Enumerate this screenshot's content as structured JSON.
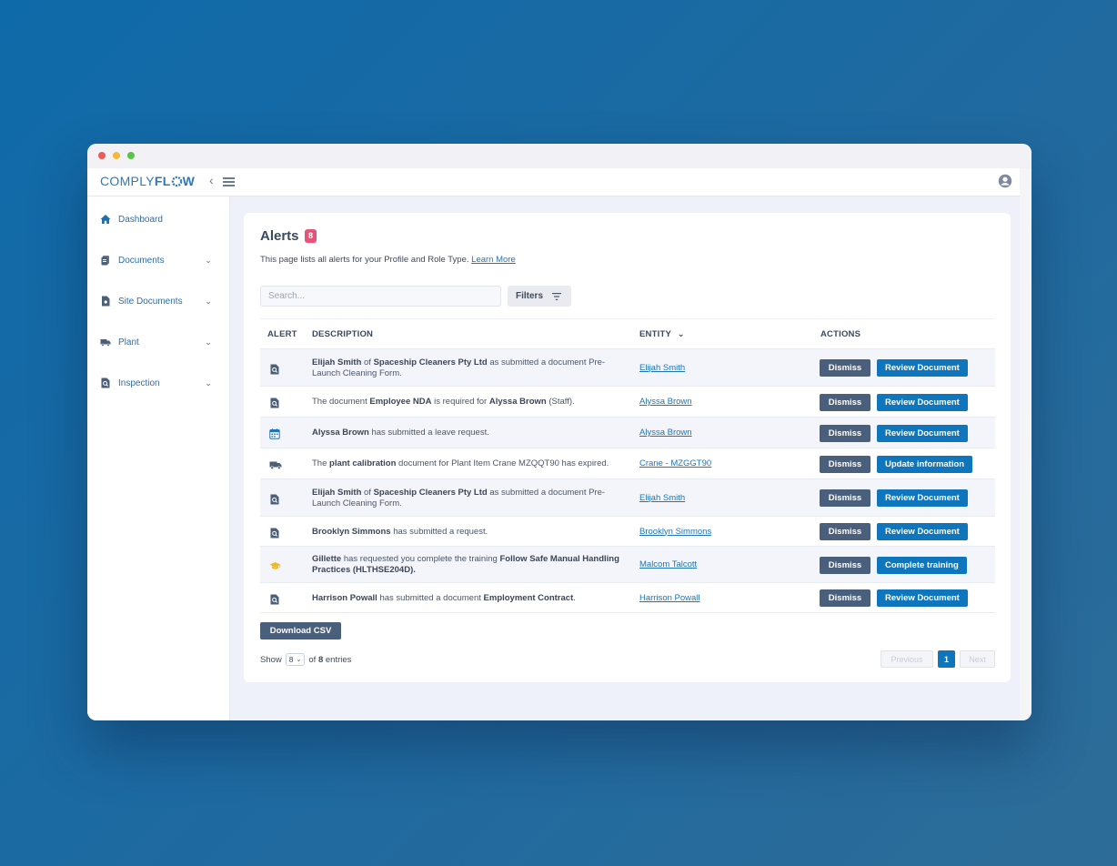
{
  "app": {
    "logo_part1": "COMPLY",
    "logo_part2": "FL",
    "logo_part3": "W"
  },
  "sidebar": {
    "items": [
      {
        "label": "Dashboard",
        "icon": "home-icon"
      },
      {
        "label": "Documents",
        "icon": "documents-icon"
      },
      {
        "label": "Site Documents",
        "icon": "site-documents-icon"
      },
      {
        "label": "Plant",
        "icon": "truck-icon"
      },
      {
        "label": "Inspection",
        "icon": "inspection-icon"
      }
    ]
  },
  "page": {
    "title": "Alerts",
    "badge_count": "8",
    "subtitle": "This page lists all alerts for your Profile and Role Type.",
    "learn_more": "Learn More",
    "search_placeholder": "Search...",
    "filters_label": "Filters"
  },
  "table": {
    "headers": {
      "alert": "ALERT",
      "description": "DESCRIPTION",
      "entity": "ENTITY",
      "actions": "ACTIONS"
    },
    "rows": [
      {
        "icon": "document-search-icon",
        "parts": [
          [
            "b",
            "Elijah Smith"
          ],
          [
            "t",
            " of "
          ],
          [
            "b",
            "Spaceship Cleaners Pty Ltd"
          ],
          [
            "t",
            " as submitted a document Pre-Launch Cleaning Form."
          ]
        ],
        "entity": "Elijah Smith",
        "dismiss": "Dismiss",
        "action": "Review Document"
      },
      {
        "icon": "document-search-icon",
        "parts": [
          [
            "t",
            "The document "
          ],
          [
            "b",
            "Employee NDA"
          ],
          [
            "t",
            " is required for "
          ],
          [
            "b",
            "Alyssa Brown"
          ],
          [
            "t",
            " (Staff)."
          ]
        ],
        "entity": "Alyssa Brown",
        "dismiss": "Dismiss",
        "action": "Review Document"
      },
      {
        "icon": "calendar-icon",
        "parts": [
          [
            "b",
            "Alyssa Brown"
          ],
          [
            "t",
            " has submitted a leave request."
          ]
        ],
        "entity": "Alyssa Brown",
        "dismiss": "Dismiss",
        "action": "Review Document"
      },
      {
        "icon": "truck-icon",
        "parts": [
          [
            "t",
            "The "
          ],
          [
            "b",
            "plant calibration"
          ],
          [
            "t",
            " document for Plant Item Crane MZQQT90 has expired."
          ]
        ],
        "entity": "Crane - MZGGT90",
        "dismiss": "Dismiss",
        "action": "Update information"
      },
      {
        "icon": "document-search-icon",
        "parts": [
          [
            "b",
            "Elijah Smith"
          ],
          [
            "t",
            " of "
          ],
          [
            "b",
            "Spaceship Cleaners Pty Ltd"
          ],
          [
            "t",
            " as submitted a document Pre-Launch Cleaning Form."
          ]
        ],
        "entity": "Elijah Smith",
        "dismiss": "Dismiss",
        "action": "Review Document"
      },
      {
        "icon": "document-search-icon",
        "parts": [
          [
            "b",
            "Brooklyn Simmons"
          ],
          [
            "t",
            " has submitted a request."
          ]
        ],
        "entity": "Brooklyn Simmons",
        "dismiss": "Dismiss",
        "action": "Review Document"
      },
      {
        "icon": "graduation-cap-icon",
        "parts": [
          [
            "b",
            "Gillette"
          ],
          [
            "t",
            " has requested you complete the training "
          ],
          [
            "b",
            "Follow Safe Manual Handling Practices (HLTHSE204D)."
          ]
        ],
        "entity": "Malcom Talcott",
        "dismiss": "Dismiss",
        "action": "Complete training"
      },
      {
        "icon": "document-search-icon",
        "parts": [
          [
            "b",
            "Harrison Powall"
          ],
          [
            "t",
            " has submitted a document "
          ],
          [
            "b",
            "Employment Contract"
          ],
          [
            "t",
            "."
          ]
        ],
        "entity": "Harrison Powall",
        "dismiss": "Dismiss",
        "action": "Review Document"
      }
    ]
  },
  "footer": {
    "download_label": "Download CSV",
    "show_label": "Show",
    "page_size": "8",
    "of_label": "of",
    "total": "8",
    "entries_label": "entries",
    "prev_label": "Previous",
    "current_page": "1",
    "next_label": "Next"
  },
  "colors": {
    "accent": "#0f76bd",
    "dismiss": "#4a5f7b",
    "badge": "#e8537a",
    "training_icon": "#f2b91c"
  }
}
